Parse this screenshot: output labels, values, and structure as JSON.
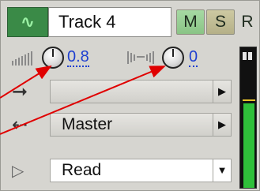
{
  "track": {
    "name": "Track 4",
    "mute_label": "M",
    "solo_label": "S",
    "record_label": "R"
  },
  "volume": {
    "value": "0.8"
  },
  "pan": {
    "value": "0"
  },
  "input_route": {
    "value": ""
  },
  "output_route": {
    "value": "Master"
  },
  "automation": {
    "value": "Read"
  },
  "meter": {
    "level_percent": 60,
    "marker_percent": 62
  },
  "colors": {
    "track_color": "#3a8a47",
    "mute_bg": "#a6d9a3",
    "solo_bg": "#cdc9a2",
    "value_text": "#1e3fd0",
    "annotation_arrow": "#e00000"
  },
  "icons": {
    "track_icon": "waveform-icon",
    "volume_icon": "volume-ramp-icon",
    "pan_icon": "pan-icon",
    "input_icon": "arrow-right-icon",
    "output_icon": "arrow-left-icon",
    "automation_icon": "play-triangle-icon"
  }
}
